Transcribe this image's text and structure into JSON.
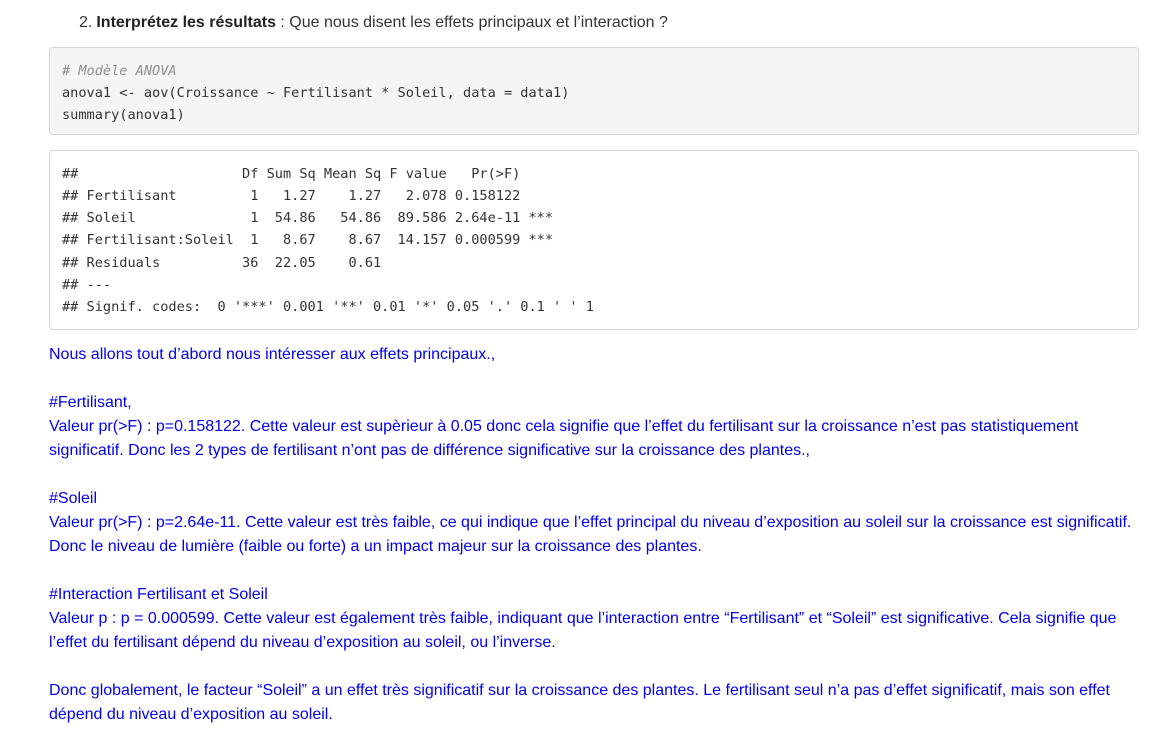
{
  "question": {
    "number": "2.",
    "bold": "Interprétez les résultats",
    "rest": " : Que nous disent les effets principaux et l’interaction ?"
  },
  "code": {
    "comment": "# Modèle ANOVA",
    "line1": "anova1 <- aov(Croissance ~ Fertilisant * Soleil, data = data1)",
    "line2": "summary(anova1)"
  },
  "output": {
    "lines": [
      "##                    Df Sum Sq Mean Sq F value   Pr(>F)    ",
      "## Fertilisant         1   1.27    1.27   2.078 0.158122    ",
      "## Soleil              1  54.86   54.86  89.586 2.64e-11 ***",
      "## Fertilisant:Soleil  1   8.67    8.67  14.157 0.000599 ***",
      "## Residuals          36  22.05    0.61                     ",
      "## ---",
      "## Signif. codes:  0 '***' 0.001 '**' 0.01 '*' 0.05 '.' 0.1 ' ' 1"
    ]
  },
  "analysis": {
    "intro": "Nous allons tout d’abord nous intéresser aux effets principaux.,",
    "fert_title": "#Fertilisant,",
    "fert_text": "Valeur pr(>F) : p=0.158122. Cette valeur est supèrieur à 0.05 donc cela signifie que l’effet du fertilisant sur la croissance n’est pas statistiquement significatif. Donc les 2 types de fertilisant n’ont pas de différence significative sur la croissance des plantes.,",
    "sol_title": "#Soleil",
    "sol_text": "Valeur pr(>F) : p=2.64e-11. Cette valeur est très faible, ce qui indique que l’effet principal du niveau d’exposition au soleil sur la croissance est significatif. Donc le niveau de lumière (faible ou forte) a un impact majeur sur la croissance des plantes.",
    "inter_title": "#Interaction Fertilisant et Soleil",
    "inter_text": "Valeur p : p = 0.000599. Cette valeur est également très faible, indiquant que l’interaction entre “Fertilisant” et “Soleil” est significative. Cela signifie que l’effet du fertilisant dépend du niveau d’exposition au soleil, ou l’inverse.",
    "conclusion": "Donc globalement, le facteur “Soleil” a un effet très significatif sur la croissance des plantes. Le fertilisant seul n’a pas d’effet significatif, mais son effet dépend du niveau d’exposition au soleil."
  },
  "colors": {
    "analysis_text": "#0000ee",
    "code_background": "#f5f5f5",
    "code_comment": "#8e908c"
  }
}
